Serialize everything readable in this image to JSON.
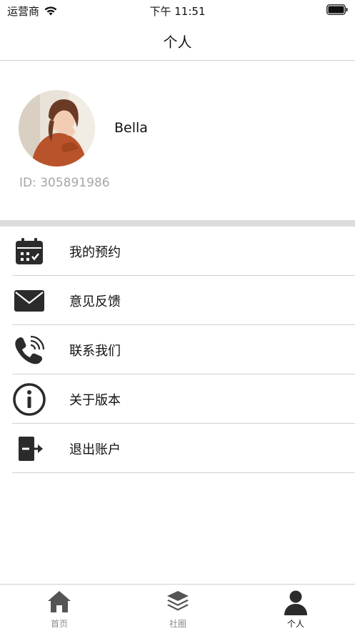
{
  "status_bar": {
    "carrier": "运营商",
    "time": "下午 11:51"
  },
  "nav": {
    "title": "个人"
  },
  "profile": {
    "name": "Bella",
    "id_text": "ID: 305891986"
  },
  "menu": {
    "items": [
      {
        "label": "我的预约",
        "icon": "calendar-icon"
      },
      {
        "label": "意见反馈",
        "icon": "mail-icon"
      },
      {
        "label": "联系我们",
        "icon": "phone-icon"
      },
      {
        "label": "关于版本",
        "icon": "info-icon"
      },
      {
        "label": "退出账户",
        "icon": "logout-icon"
      }
    ]
  },
  "tabs": [
    {
      "label": "首页",
      "icon": "home-icon",
      "active": false
    },
    {
      "label": "社圈",
      "icon": "layers-icon",
      "active": false
    },
    {
      "label": "个人",
      "icon": "person-icon",
      "active": true
    }
  ],
  "colors": {
    "icon": "#2b2b2b",
    "inactive_tab": "#8a8a8a",
    "id_text": "#a6a6a6",
    "divider": "#dcdcdc"
  }
}
